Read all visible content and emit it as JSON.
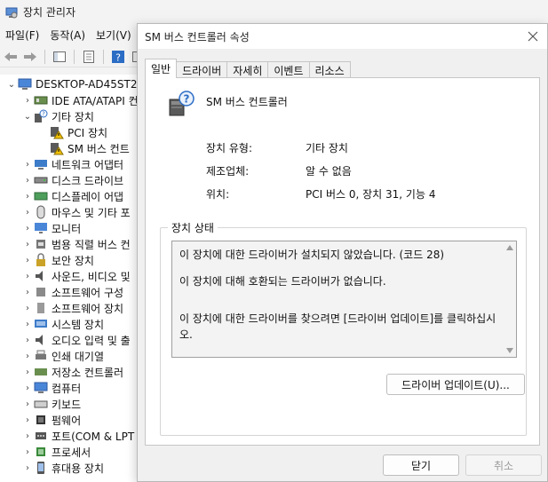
{
  "device_manager": {
    "title": "장치 관리자",
    "menu": [
      "파일(F)",
      "동작(A)",
      "보기(V)"
    ],
    "tree": [
      {
        "label": "DESKTOP-AD45ST2",
        "icon": "computer-icon",
        "expander": "⌄"
      },
      {
        "label": "IDE ATA/ATAPI 컨",
        "icon": "ide-controller-icon",
        "expander": "›"
      },
      {
        "label": "기타 장치",
        "icon": "unknown-device-icon",
        "expander": "⌄"
      },
      {
        "label": "PCI 장치",
        "icon": "warning-device-icon",
        "expander": ""
      },
      {
        "label": "SM 버스 컨트",
        "icon": "warning-device-icon",
        "expander": ""
      },
      {
        "label": "네트워크 어댑터",
        "icon": "network-adapter-icon",
        "expander": "›"
      },
      {
        "label": "디스크 드라이브",
        "icon": "disk-drive-icon",
        "expander": "›"
      },
      {
        "label": "디스플레이 어댑",
        "icon": "display-adapter-icon",
        "expander": "›"
      },
      {
        "label": "마우스 및 기타 포",
        "icon": "mouse-icon",
        "expander": "›"
      },
      {
        "label": "모니터",
        "icon": "monitor-icon",
        "expander": "›"
      },
      {
        "label": "범용 직렬 버스 컨",
        "icon": "usb-controller-icon",
        "expander": "›"
      },
      {
        "label": "보안 장치",
        "icon": "security-device-icon",
        "expander": "›"
      },
      {
        "label": "사운드, 비디오 및",
        "icon": "sound-icon",
        "expander": "›"
      },
      {
        "label": "소프트웨어 구성",
        "icon": "software-component-icon",
        "expander": "›"
      },
      {
        "label": "소프트웨어 장치",
        "icon": "software-device-icon",
        "expander": "›"
      },
      {
        "label": "시스템 장치",
        "icon": "system-device-icon",
        "expander": "›"
      },
      {
        "label": "오디오 입력 및 출",
        "icon": "audio-io-icon",
        "expander": "›"
      },
      {
        "label": "인쇄 대기열",
        "icon": "print-queue-icon",
        "expander": "›"
      },
      {
        "label": "저장소 컨트롤러",
        "icon": "storage-controller-icon",
        "expander": "›"
      },
      {
        "label": "컴퓨터",
        "icon": "computer-icon",
        "expander": "›"
      },
      {
        "label": "키보드",
        "icon": "keyboard-icon",
        "expander": "›"
      },
      {
        "label": "펌웨어",
        "icon": "firmware-icon",
        "expander": "›"
      },
      {
        "label": "포트(COM & LPT",
        "icon": "port-icon",
        "expander": "›"
      },
      {
        "label": "프로세서",
        "icon": "processor-icon",
        "expander": "›"
      },
      {
        "label": "휴대용 장치",
        "icon": "portable-device-icon",
        "expander": "›"
      }
    ]
  },
  "dialog": {
    "title": "SM 버스 컨트롤러 속성",
    "tabs": [
      "일반",
      "드라이버",
      "자세히",
      "이벤트",
      "리소스"
    ],
    "active_tab": "일반",
    "device_name": "SM 버스 컨트롤러",
    "properties": [
      {
        "label": "장치 유형:",
        "value": "기타 장치"
      },
      {
        "label": "제조업체:",
        "value": "알 수 없음"
      },
      {
        "label": "위치:",
        "value": "PCI 버스 0, 장치 31, 기능 4"
      }
    ],
    "status_legend": "장치 상태",
    "status_lines": [
      "이 장치에 대한 드라이버가 설치되지 않았습니다. (코드 28)",
      "이 장치에 대해 호환되는 드라이버가 없습니다.",
      "이 장치에 대한 드라이버를 찾으려면 [드라이버 업데이트]를 클릭하십시오."
    ],
    "update_driver_button": "드라이버 업데이트(U)...",
    "ok_button": "닫기",
    "cancel_button": "취소"
  },
  "colors": {
    "accent_blue": "#2b6cc4",
    "warning_yellow": "#f2c200",
    "disabled_text": "#9c9c9c"
  }
}
